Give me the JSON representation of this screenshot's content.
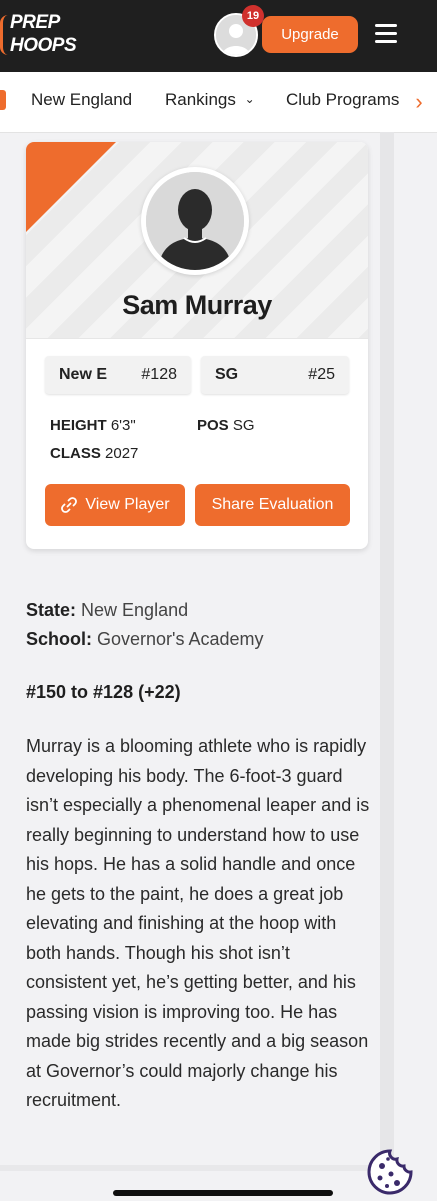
{
  "header": {
    "logo_line1": "PREP",
    "logo_line2": "HOOPS",
    "notifications_count": "19",
    "upgrade_label": "Upgrade"
  },
  "nav": {
    "items": [
      "New England",
      "Rankings",
      "Club Programs"
    ]
  },
  "player": {
    "name": "Sam Murray",
    "region_rank_label": "New E",
    "region_rank_value": "#128",
    "pos_rank_label": "SG",
    "pos_rank_value": "#25",
    "height_label": "HEIGHT",
    "height_value": "6'3\"",
    "class_label": "CLASS",
    "class_value": "2027",
    "pos_label": "POS",
    "pos_value": "SG",
    "view_button": "View Player",
    "share_button": "Share Evaluation"
  },
  "article": {
    "state_label": "State:",
    "state_value": "New England",
    "school_label": "School:",
    "school_value": "Governor's Academy",
    "rank_change": "#150 to #128 (+22)",
    "paragraph": "Murray is a blooming athlete who is rapidly developing his body. The 6-foot-3 guard isn’t especially a phenomenal leaper and is really beginning to understand how to use his hops. He has a solid handle and once he gets to the paint, he does a great job elevating and finishing at the hoop with both hands. Though his shot isn’t consistent yet, he’s getting better, and his passing vision is improving too. He has made big strides recently and a big season at Governor’s could majorly change his recruitment."
  },
  "colors": {
    "brand_orange": "#ee6c2d",
    "header_dark": "#1f1f1f",
    "badge_red": "#d0312d"
  }
}
